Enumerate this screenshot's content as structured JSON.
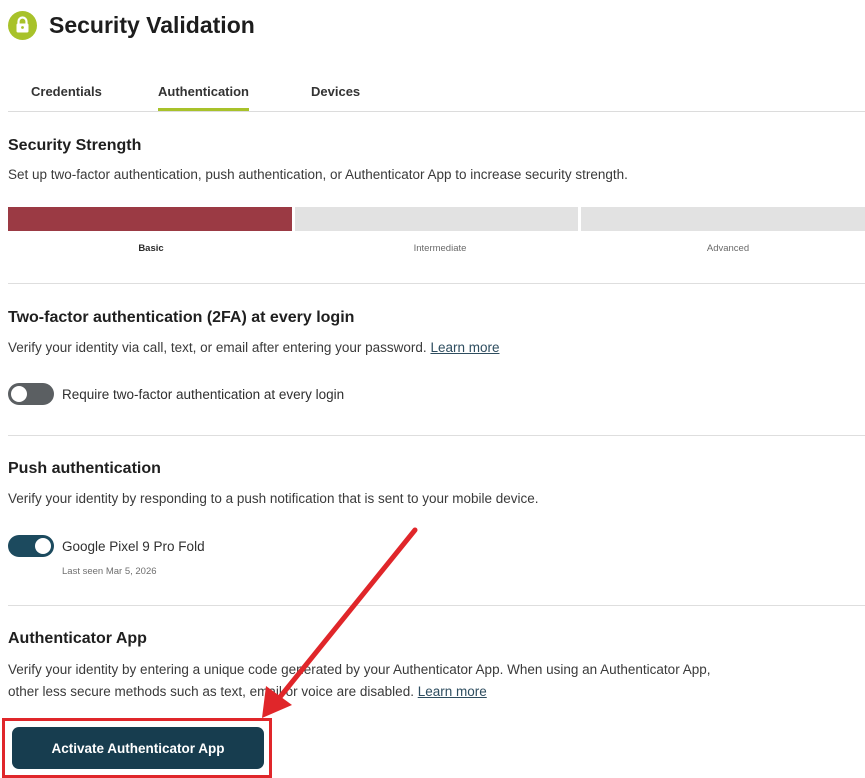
{
  "colors": {
    "accent": "#a8c22a",
    "strength_fill": "#9b3a44",
    "strength_empty": "#e2e2e2",
    "toggle_off": "#5b5f62",
    "toggle_on": "#1c4a5e",
    "button_bg": "#173d4f",
    "annotation_red": "#e0262a"
  },
  "header": {
    "icon": "lock-icon",
    "title": "Security Validation"
  },
  "tabs": [
    {
      "label": "Credentials",
      "active": false
    },
    {
      "label": "Authentication",
      "active": true
    },
    {
      "label": "Devices",
      "active": false
    }
  ],
  "strength": {
    "title": "Security Strength",
    "description": "Set up two-factor authentication, push authentication, or Authenticator App to increase security strength.",
    "levels": [
      "Basic",
      "Intermediate",
      "Advanced"
    ],
    "current_level": "Basic",
    "filled_segments": 1,
    "total_segments": 3
  },
  "two_factor": {
    "title": "Two-factor authentication (2FA) at every login",
    "description": "Verify your identity via call, text, or email after entering your password.",
    "learn_more": "Learn more",
    "toggle_label": "Require two-factor authentication at every login",
    "toggle_on": false
  },
  "push": {
    "title": "Push authentication",
    "description": "Verify your identity by responding to a push notification that is sent to your mobile device.",
    "device_name": "Google Pixel 9 Pro Fold",
    "device_last_seen": "Last seen Mar 5, 2026",
    "toggle_on": true
  },
  "authenticator": {
    "title": "Authenticator App",
    "description_line1": "Verify your identity by entering a unique code generated by your Authenticator App. When using an Authenticator App,",
    "description_line2": "other less secure methods such as text, email or voice are disabled.",
    "learn_more": "Learn more",
    "button_label": "Activate Authenticator App"
  }
}
